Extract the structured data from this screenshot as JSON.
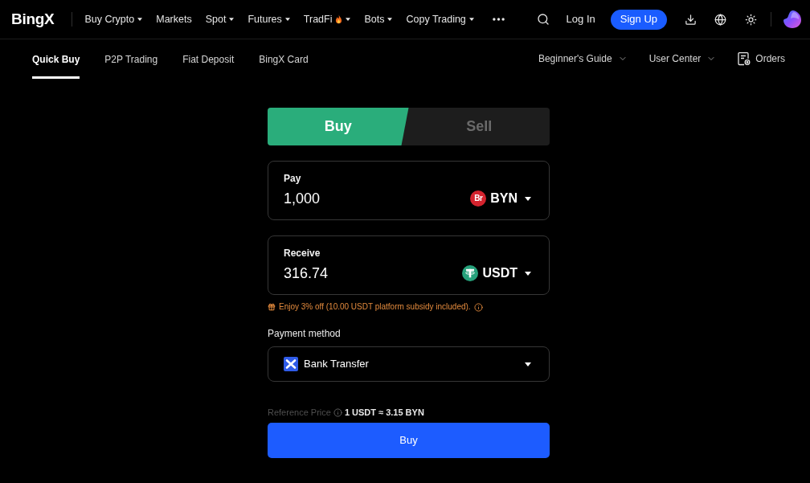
{
  "nav": {
    "logo": "BingX",
    "items": [
      {
        "label": "Buy Crypto",
        "dropdown": true,
        "hot": false
      },
      {
        "label": "Markets",
        "dropdown": false,
        "hot": false
      },
      {
        "label": "Spot",
        "dropdown": true,
        "hot": false
      },
      {
        "label": "Futures",
        "dropdown": true,
        "hot": false
      },
      {
        "label": "TradFi",
        "dropdown": true,
        "hot": true
      },
      {
        "label": "Bots",
        "dropdown": true,
        "hot": false
      },
      {
        "label": "Copy Trading",
        "dropdown": true,
        "hot": false
      }
    ],
    "login": "Log In",
    "signup": "Sign Up"
  },
  "subnav": {
    "tabs": [
      {
        "label": "Quick Buy",
        "selected": true
      },
      {
        "label": "P2P Trading",
        "selected": false
      },
      {
        "label": "Fiat Deposit",
        "selected": false
      },
      {
        "label": "BingX Card",
        "selected": false
      }
    ],
    "links": [
      {
        "label": "Beginner's Guide",
        "dropdown": true
      },
      {
        "label": "User Center",
        "dropdown": true
      }
    ],
    "orders": "Orders"
  },
  "trade": {
    "mode_tabs": [
      {
        "label": "Buy",
        "selected": true
      },
      {
        "label": "Sell",
        "selected": false
      }
    ],
    "amounts": [
      {
        "label": "Pay",
        "value": "1,000",
        "currency": {
          "code": "BYN",
          "kind": "fiat",
          "symbol": "Br"
        }
      },
      {
        "label": "Receive",
        "value": "316.74",
        "currency": {
          "code": "USDT",
          "kind": "tether"
        }
      }
    ],
    "promo": "Enjoy 3% off (10.00 USDT platform subsidy included).",
    "payment": {
      "label": "Payment method",
      "value": "Bank Transfer"
    },
    "reference": {
      "label": "Reference Price",
      "value": "1 USDT ≈ 3.15 BYN"
    },
    "submit": "Buy"
  }
}
